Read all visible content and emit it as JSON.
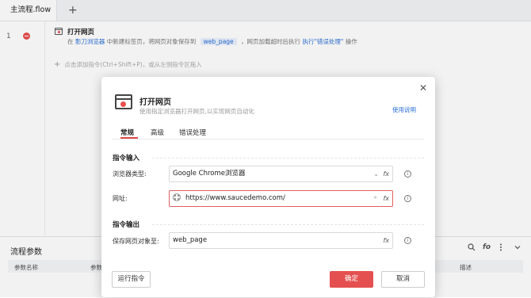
{
  "tabbar": {
    "tab_label": "主流程.flow",
    "add_label": "+"
  },
  "editor": {
    "line_number": "1",
    "step": {
      "title": "打开网页",
      "desc_prefix": "在",
      "browser_link": "影刀浏览器",
      "desc_mid": "中新建标签页，将网页对象保存到",
      "var_chip": "web_page",
      "desc_mid2": "，网页加载超时后执行",
      "error_link": "执行\"错误处理\"",
      "desc_suffix": "操作"
    },
    "add_hint": "点击添加指令(Ctrl+Shift+P)，或从左侧指令区拖入"
  },
  "params": {
    "title": "流程参数",
    "col1": "参数名称",
    "col2": "参数",
    "col3": "描述",
    "fo_label": "fo"
  },
  "dialog": {
    "title": "打开网页",
    "subtitle": "使用指定浏览器打开网页,以实现网页自动化",
    "help_link": "使用说明",
    "tabs": [
      "常规",
      "高级",
      "错误处理"
    ],
    "section_input": "指令输入",
    "browser_label": "浏览器类型:",
    "browser_value": "Google Chrome浏览器",
    "url_label": "网址:",
    "url_value": "https://www.saucedemo.com/",
    "section_output": "指令输出",
    "save_label": "保存网页对象至:",
    "save_value": "web_page",
    "fx_label": "fx",
    "info_label": "i",
    "run_button": "运行指令",
    "ok_button": "确定",
    "cancel_button": "取消",
    "close_label": "✕"
  },
  "colors": {
    "accent": "#e45050",
    "link": "#2a6fd6"
  }
}
